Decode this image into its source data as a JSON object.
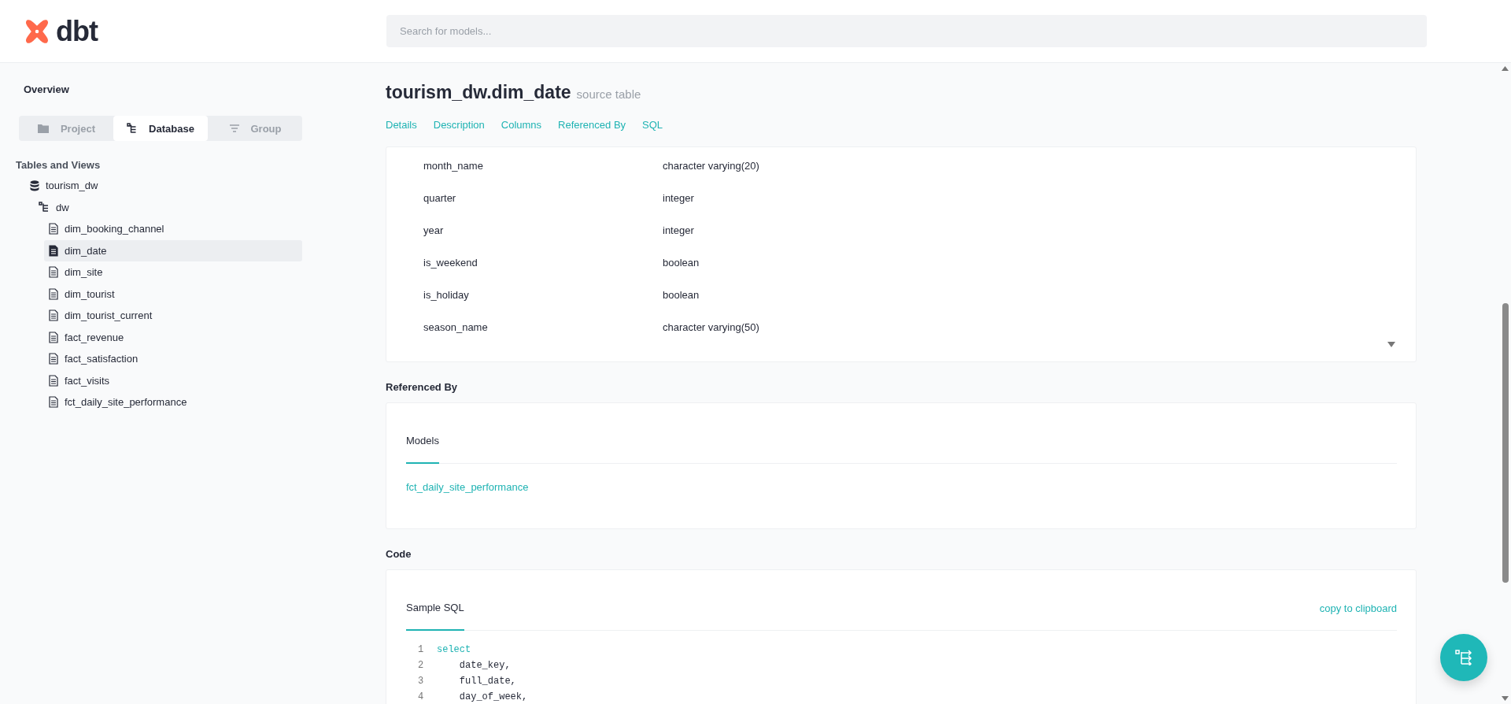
{
  "logo": {
    "text": "dbt"
  },
  "search": {
    "placeholder": "Search for models..."
  },
  "sidebar": {
    "overview": "Overview",
    "tabs": [
      {
        "label": "Project",
        "kind": "folder",
        "selected": false
      },
      {
        "label": "Database",
        "kind": "tree",
        "selected": true
      },
      {
        "label": "Group",
        "kind": "filter",
        "selected": false
      }
    ],
    "section_title": "Tables and Views",
    "tree": [
      {
        "label": "tourism_dw",
        "kind": "database",
        "selected": false,
        "children": [
          {
            "label": "dw",
            "kind": "schema",
            "selected": false,
            "children": [
              {
                "label": "dim_booking_channel",
                "kind": "table",
                "selected": false
              },
              {
                "label": "dim_date",
                "kind": "table",
                "selected": true
              },
              {
                "label": "dim_site",
                "kind": "table",
                "selected": false
              },
              {
                "label": "dim_tourist",
                "kind": "table",
                "selected": false
              },
              {
                "label": "dim_tourist_current",
                "kind": "table",
                "selected": false
              },
              {
                "label": "fact_revenue",
                "kind": "table",
                "selected": false
              },
              {
                "label": "fact_satisfaction",
                "kind": "table",
                "selected": false
              },
              {
                "label": "fact_visits",
                "kind": "table",
                "selected": false
              },
              {
                "label": "fct_daily_site_performance",
                "kind": "table",
                "selected": false
              }
            ]
          }
        ]
      }
    ]
  },
  "page": {
    "title": "tourism_dw.dim_date",
    "subtitle": "source table",
    "nav": [
      "Details",
      "Description",
      "Columns",
      "Referenced By",
      "SQL"
    ],
    "columns": [
      {
        "name": "month_name",
        "type": "character varying(20)"
      },
      {
        "name": "quarter",
        "type": "integer"
      },
      {
        "name": "year",
        "type": "integer"
      },
      {
        "name": "is_weekend",
        "type": "boolean"
      },
      {
        "name": "is_holiday",
        "type": "boolean"
      },
      {
        "name": "season_name",
        "type": "character varying(50)"
      }
    ],
    "referenced_by": {
      "heading": "Referenced By",
      "tabs": [
        {
          "label": "Models",
          "selected": true
        }
      ],
      "links": [
        "fct_daily_site_performance"
      ]
    },
    "code": {
      "heading": "Code",
      "tabs": [
        {
          "label": "Sample SQL",
          "selected": true
        }
      ],
      "copy_label": "copy to clipboard",
      "lines": [
        {
          "number": "1",
          "text": "select",
          "kind": "keyword"
        },
        {
          "number": "2",
          "text": "    date_key,",
          "kind": "plain"
        },
        {
          "number": "3",
          "text": "    full_date,",
          "kind": "plain"
        },
        {
          "number": "4",
          "text": "    day_of_week,",
          "kind": "plain"
        }
      ]
    }
  }
}
